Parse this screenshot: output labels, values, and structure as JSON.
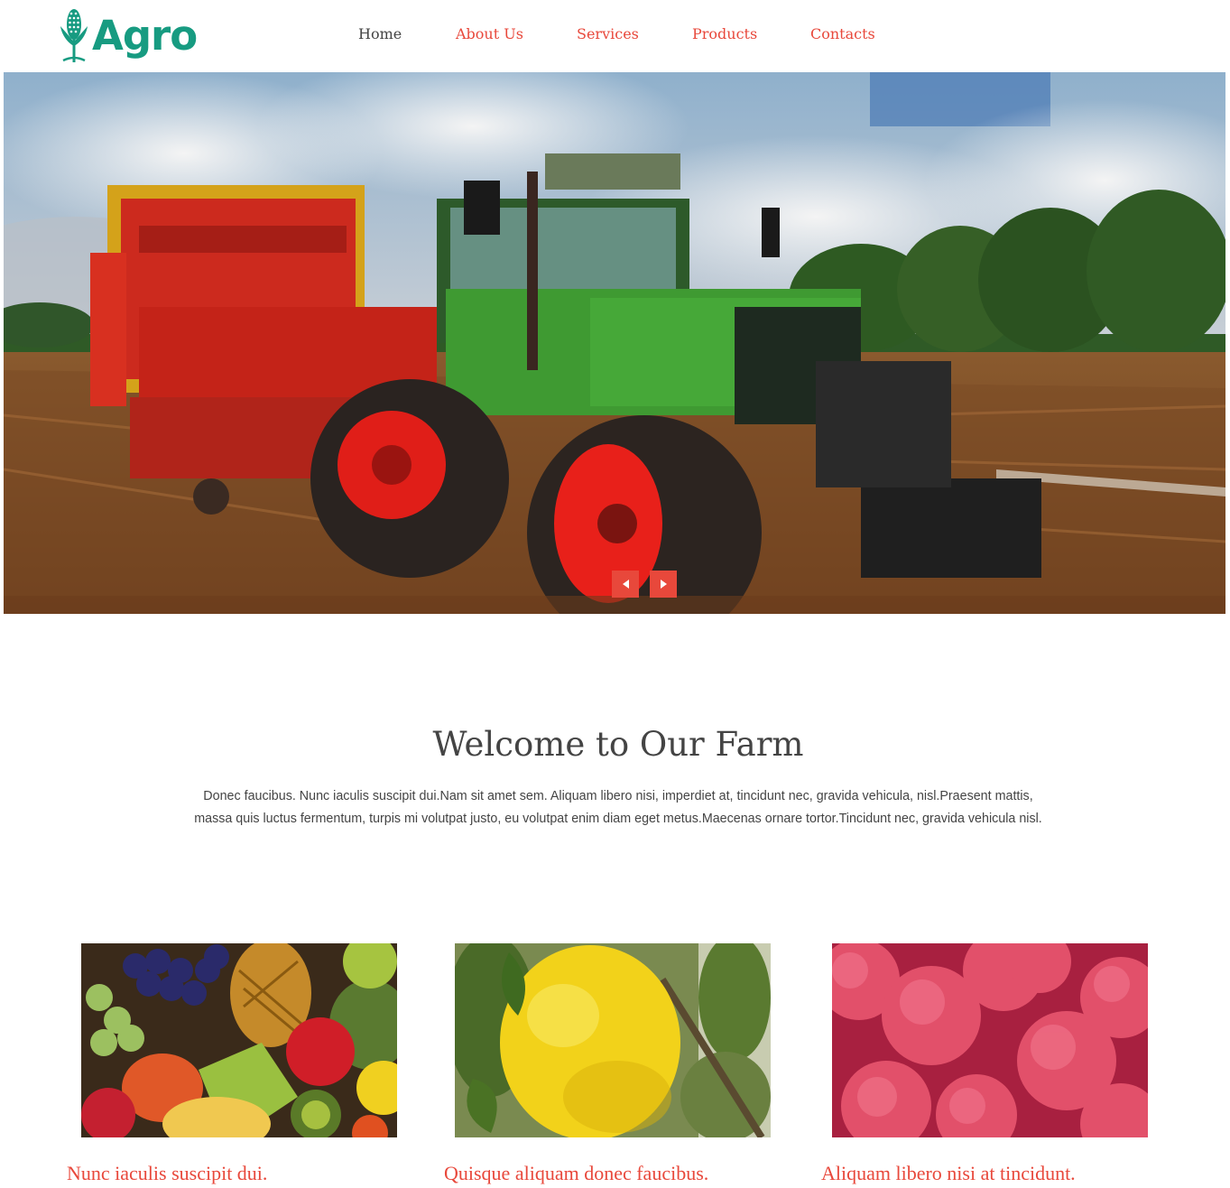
{
  "brand": {
    "name": "Agro",
    "color": "#179b81",
    "icon": "corn-sprout-icon"
  },
  "nav": {
    "items": [
      {
        "label": "Home",
        "active": true
      },
      {
        "label": "About Us",
        "active": false
      },
      {
        "label": "Services",
        "active": false
      },
      {
        "label": "Products",
        "active": false
      },
      {
        "label": "Contacts",
        "active": false
      }
    ]
  },
  "hero": {
    "image": "tractor-with-harvester-in-field",
    "controls": {
      "prev_icon": "arrow-left-icon",
      "next_icon": "arrow-right-icon"
    }
  },
  "welcome": {
    "title": "Welcome to Our Farm",
    "text": "Donec faucibus. Nunc iaculis suscipit dui.Nam sit amet sem. Aliquam libero nisi, imperdiet at, tincidunt nec, gravida vehicula, nisl.Praesent mattis, massa quis luctus fermentum, turpis mi volutpat justo, eu volutpat enim diam eget metus.Maecenas ornare tortor.Tincidunt nec, gravida vehicula nisl."
  },
  "cards": [
    {
      "image": "mixed-fruits-photo",
      "title": "Nunc iaculis suscipit dui."
    },
    {
      "image": "lemon-on-tree-photo",
      "title": "Quisque aliquam donec faucibus."
    },
    {
      "image": "lychees-photo",
      "title": "Aliquam libero nisi at tincidunt."
    }
  ],
  "colors": {
    "accent": "#e8483b",
    "text": "#444444",
    "brand": "#179b81"
  }
}
